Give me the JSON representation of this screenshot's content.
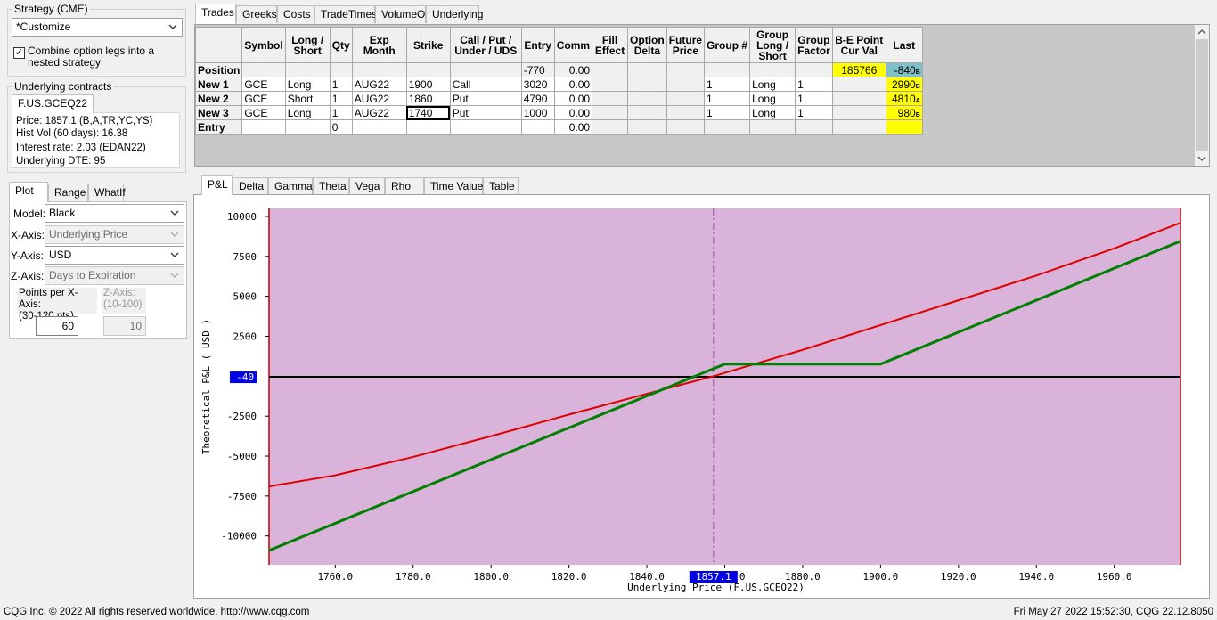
{
  "strategy": {
    "group_label": "Strategy (CME)",
    "selected": "*Customize",
    "combine_checked": true,
    "combine_label_line1": "Combine option legs into a",
    "combine_label_line2": "nested strategy"
  },
  "underlying": {
    "group_label": "Underlying contracts",
    "tab": "F.US.GCEQ22",
    "price": "Price: 1857.1 (B,A,TR,YC,YS)",
    "hist_vol": "Hist Vol (60 days): 16.38",
    "interest": "Interest rate: 2.03 (EDAN22)",
    "dte": "Underlying DTE: 95"
  },
  "plot_panel": {
    "tabs": [
      "Plot",
      "Range",
      "WhatIf"
    ],
    "model_label": "Model:",
    "model_value": "Black",
    "xaxis_label": "X-Axis:",
    "xaxis_value": "Underlying Price",
    "yaxis_label": "Y-Axis:",
    "yaxis_value": "USD",
    "zaxis_label": "Z-Axis:",
    "zaxis_value": "Days to Expiration",
    "points_x_label1": "Points per X-Axis:",
    "points_x_label2": "(30-120 pts)",
    "points_x_value": "60",
    "points_z_label1": "Z-Axis:",
    "points_z_label2": "(10-100)",
    "points_z_value": "10"
  },
  "top_tabs": [
    "Trades",
    "Greeks",
    "Costs",
    "TradeTimes",
    "VolumeOI",
    "Underlying"
  ],
  "grid": {
    "headers": [
      "",
      "Symbol",
      "Long / Short",
      "Qty",
      "Exp Month",
      "Strike",
      "Call / Put / Under / UDS",
      "Entry",
      "Comm",
      "Fill Effect",
      "Option Delta",
      "Future Price",
      "Group #",
      "Group Long / Short",
      "Group Factor",
      "B-E Point Cur Val",
      "Last"
    ],
    "position": {
      "label": "Position",
      "entry": "-770",
      "comm": "0.00",
      "be": "185766",
      "last": "-840",
      "last_tag": "B"
    },
    "rows": [
      {
        "label": "New 1",
        "symbol": "GCE",
        "ls": "Long",
        "qty": "1",
        "exp": "AUG22",
        "strike": "1900",
        "cp": "Call",
        "entry": "3020",
        "comm": "0.00",
        "group": "1",
        "gls": "Long",
        "gf": "1",
        "last": "2990",
        "tag": "B"
      },
      {
        "label": "New 2",
        "symbol": "GCE",
        "ls": "Short",
        "qty": "1",
        "exp": "AUG22",
        "strike": "1860",
        "cp": "Put",
        "entry": "4790",
        "comm": "0.00",
        "group": "1",
        "gls": "Long",
        "gf": "1",
        "last": "4810",
        "tag": "A"
      },
      {
        "label": "New 3",
        "symbol": "GCE",
        "ls": "Long",
        "qty": "1",
        "exp": "AUG22",
        "strike": "1740",
        "cp": "Put",
        "entry": "1000",
        "comm": "0.00",
        "group": "1",
        "gls": "Long",
        "gf": "1",
        "last": "980",
        "tag": "B"
      }
    ],
    "entry_row": {
      "label": "Entry",
      "qty": "0",
      "comm": "0.00"
    }
  },
  "chart_tabs": [
    "P&L",
    "Delta",
    "Gamma",
    "Theta",
    "Vega",
    "Rho",
    "Time Value",
    "Table"
  ],
  "chart_data": {
    "type": "line",
    "xlabel": "Underlying Price (F.US.GCEQ22)",
    "ylabel": "Theoretical P&L ( USD )",
    "xlim": [
      1743,
      1977
    ],
    "ylim": [
      -11800,
      10500
    ],
    "x_ticks": [
      1760,
      1780,
      1800,
      1820,
      1840,
      1860,
      1880,
      1900,
      1920,
      1940,
      1960
    ],
    "x_tick_labels": [
      "1760.0",
      "1780.0",
      "1800.0",
      "1820.0",
      "1840.0",
      "",
      "1880.0",
      "1900.0",
      "1920.0",
      "1940.0",
      "1960.0"
    ],
    "y_ticks": [
      10000,
      7500,
      5000,
      2500,
      -2500,
      -5000,
      -7500,
      -10000
    ],
    "y_tick_labels": [
      "10000",
      "7500",
      "5000",
      "2500",
      "-2500",
      "-5000",
      "-7500",
      "-10000"
    ],
    "current_price": 1857.1,
    "current_price_label": "1857.1",
    "current_price_suffix": "0",
    "current_pl": -40,
    "current_pl_label": "-40",
    "background": "#d9b3d9",
    "series": [
      {
        "color": "#e00000",
        "x": [
          1743,
          1760,
          1780,
          1800,
          1820,
          1840,
          1857.1,
          1880,
          1900,
          1920,
          1940,
          1960,
          1977
        ],
        "values": [
          -6900,
          -6200,
          -5050,
          -3750,
          -2400,
          -1100,
          0,
          1650,
          3200,
          4750,
          6300,
          8000,
          9600
        ]
      },
      {
        "color": "#008000",
        "x": [
          1743,
          1860,
          1900,
          1977
        ],
        "values": [
          -10900,
          760,
          760,
          8450
        ]
      }
    ]
  },
  "status_bar": {
    "left": "CQG Inc. © 2022 All rights reserved worldwide. http://www.cqg.com",
    "right": "Fri May 27 2022 15:52:30, CQG 22.12.8050"
  }
}
